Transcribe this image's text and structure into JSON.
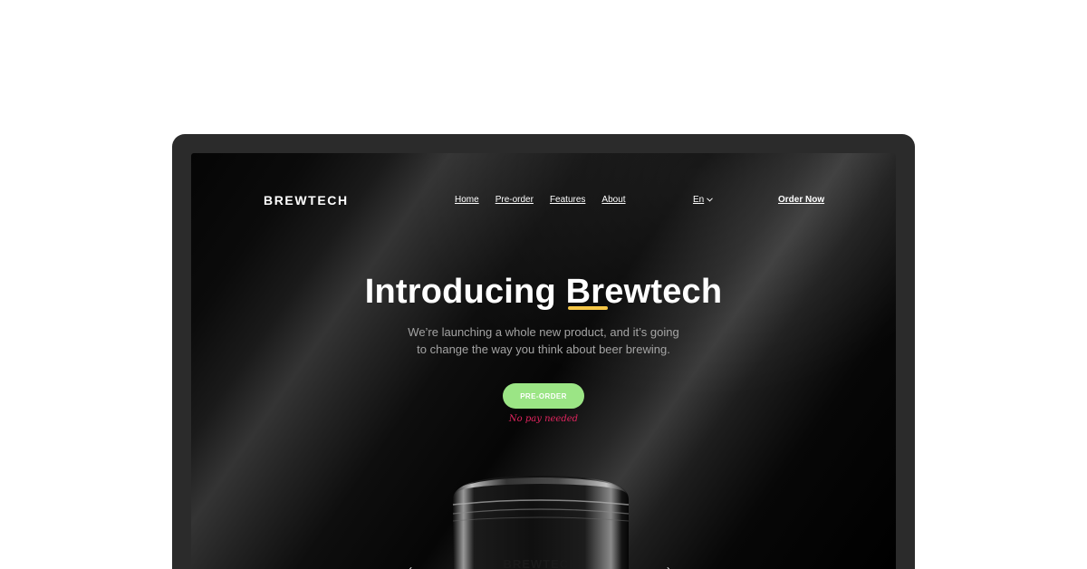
{
  "brand": "BREWTECH",
  "nav": {
    "items": [
      {
        "label": "Home"
      },
      {
        "label": "Pre-order"
      },
      {
        "label": "Features"
      },
      {
        "label": "About"
      }
    ],
    "language": "En",
    "order_label": "Order Now"
  },
  "hero": {
    "title_prefix": "Introducing",
    "title_highlight": "Brewtech",
    "subtitle_line1": "We’re launching a whole new product, and it’s going",
    "subtitle_line2": "to change the way you think about beer brewing.",
    "cta_label": "PRE-ORDER",
    "cta_note": "No pay needed"
  },
  "product": {
    "label": "BREWTECH"
  },
  "colors": {
    "accent_green": "#9be585",
    "highlight_yellow": "#f5c542",
    "note_pink": "#e0245e",
    "frame": "#2b2b2b"
  },
  "icons": [
    "chevron-down-icon",
    "chevron-left-icon",
    "chevron-right-icon"
  ]
}
